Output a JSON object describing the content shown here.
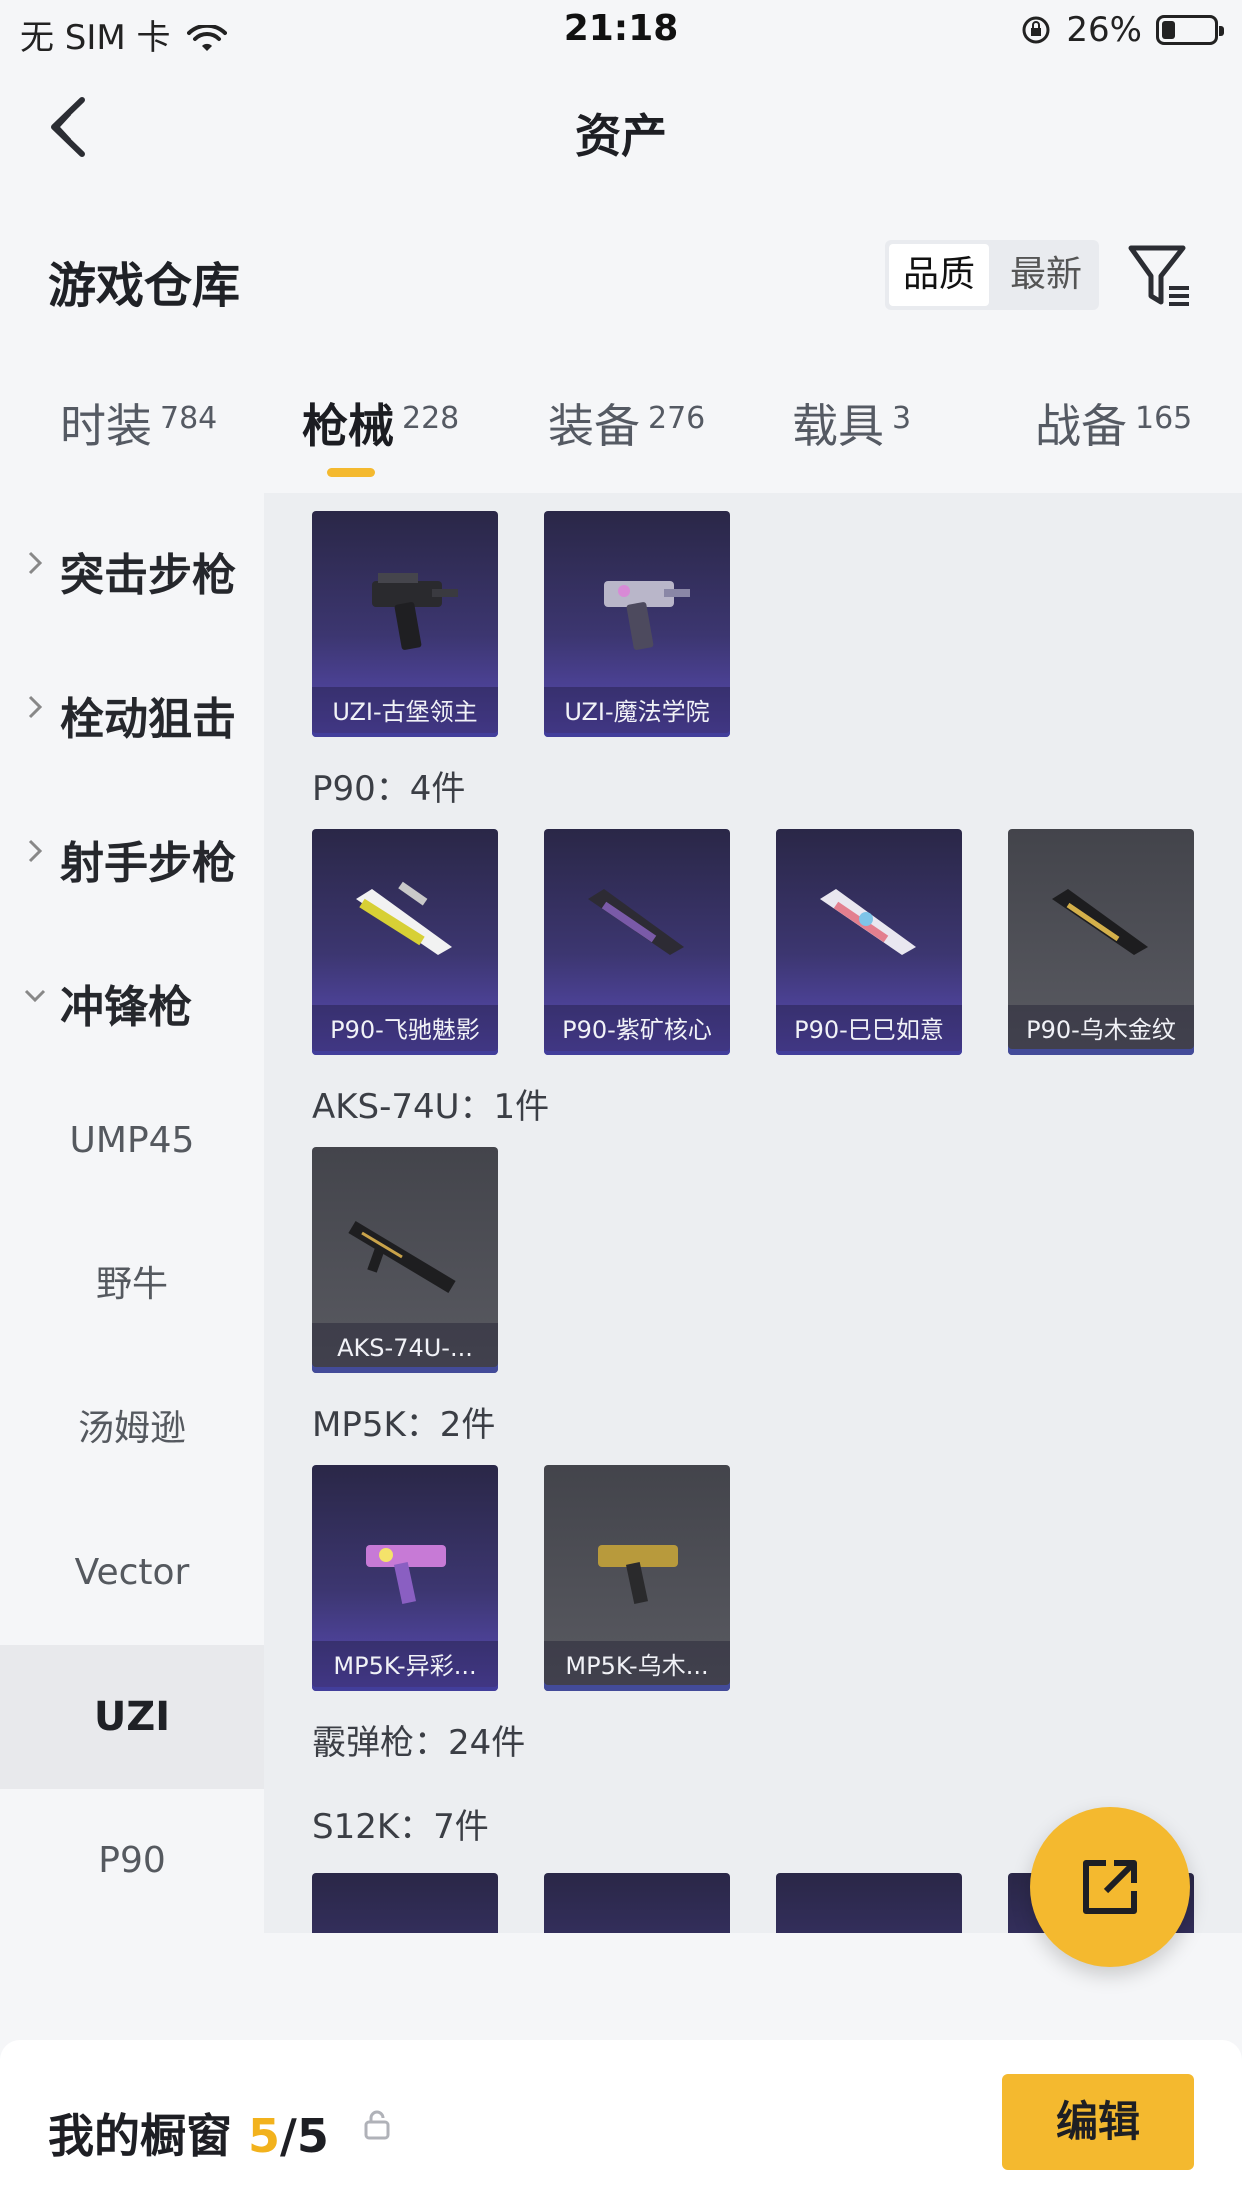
{
  "status_bar": {
    "carrier": "无 SIM 卡",
    "time": "21:18",
    "battery_percent": "26%",
    "battery_level": 0.26
  },
  "nav": {
    "title": "资产"
  },
  "header": {
    "title": "游戏仓库",
    "sort_options": [
      "品质",
      "最新"
    ],
    "active_sort": "品质"
  },
  "tabs": [
    {
      "label": "时装",
      "count": "784"
    },
    {
      "label": "枪械",
      "count": "228"
    },
    {
      "label": "装备",
      "count": "276"
    },
    {
      "label": "载具",
      "count": "3"
    },
    {
      "label": "战备",
      "count": "165"
    }
  ],
  "active_tab": "枪械",
  "categories": [
    {
      "label": "突击步枪",
      "expanded": false
    },
    {
      "label": "栓动狙击",
      "expanded": false
    },
    {
      "label": "射手步枪",
      "expanded": false
    },
    {
      "label": "冲锋枪",
      "expanded": true
    }
  ],
  "subcategories": [
    "UMP45",
    "野牛",
    "汤姆逊",
    "Vector",
    "UZI",
    "P90"
  ],
  "active_subcategory": "UZI",
  "groups": [
    {
      "title": "",
      "items": [
        {
          "name": "UZI-古堡领主",
          "quality": "purple"
        },
        {
          "name": "UZI-魔法学院",
          "quality": "purple"
        }
      ]
    },
    {
      "title": "P90：4件",
      "items": [
        {
          "name": "P90-飞驰魅影",
          "quality": "purple"
        },
        {
          "name": "P90-紫矿核心",
          "quality": "purple"
        },
        {
          "name": "P90-巳巳如意",
          "quality": "purple"
        },
        {
          "name": "P90-乌木金纹",
          "quality": "gray"
        }
      ]
    },
    {
      "title": "AKS-74U：1件",
      "items": [
        {
          "name": "AKS-74U-...",
          "quality": "gray"
        }
      ]
    },
    {
      "title": "MP5K：2件",
      "items": [
        {
          "name": "MP5K-异彩...",
          "quality": "purple"
        },
        {
          "name": "MP5K-乌木...",
          "quality": "gray"
        }
      ]
    },
    {
      "title": "霰弹枪：24件",
      "items": []
    },
    {
      "title": "S12K：7件",
      "items": []
    }
  ],
  "showcase": {
    "label": "我的橱窗",
    "current": "5",
    "total": "/5",
    "edit_label": "编辑"
  },
  "colors": {
    "accent": "#f4b92f",
    "purple_card": "#3c3670",
    "gray_card": "#55565d"
  }
}
